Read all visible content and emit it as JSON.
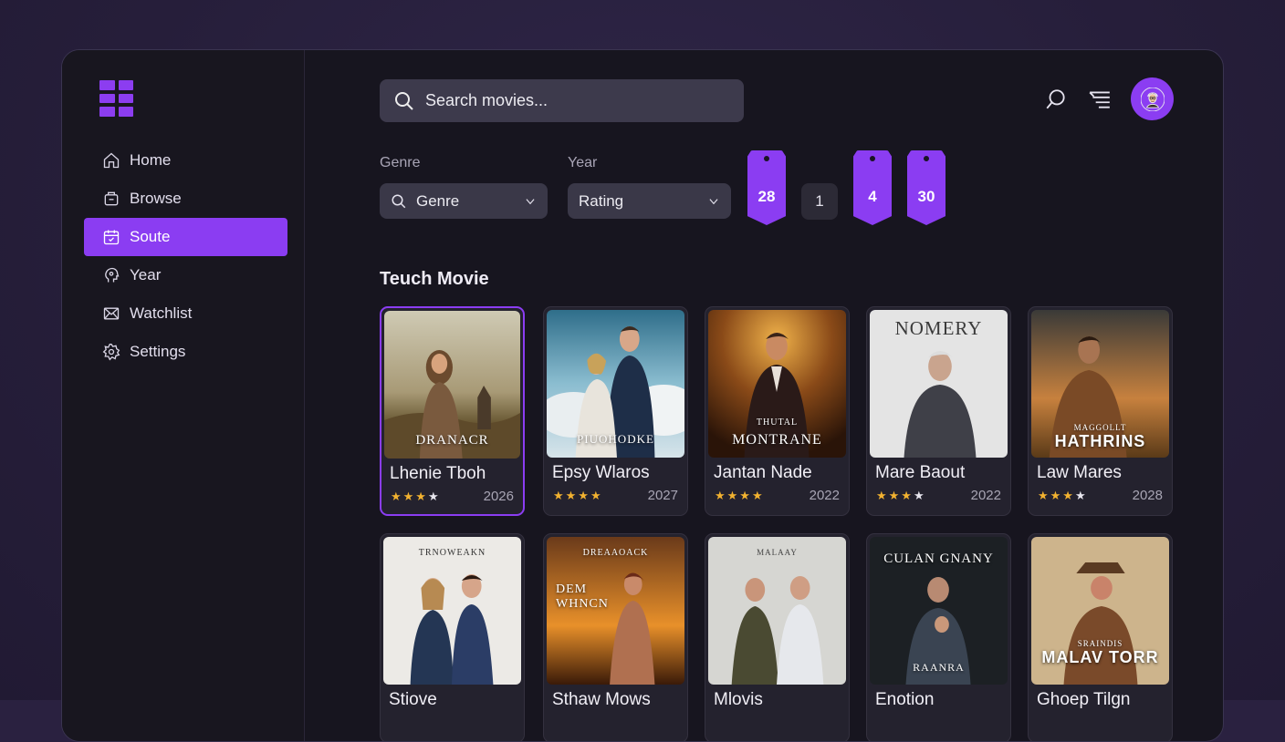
{
  "sidebar": {
    "items": [
      {
        "label": "Home",
        "icon": "home-icon",
        "active": false
      },
      {
        "label": "Browse",
        "icon": "browse-icon",
        "active": false
      },
      {
        "label": "Soute",
        "icon": "calendar-icon",
        "active": true
      },
      {
        "label": "Year",
        "icon": "head-icon",
        "active": false
      },
      {
        "label": "Watchlist",
        "icon": "envelope-icon",
        "active": false
      },
      {
        "label": "Settings",
        "icon": "gear-icon",
        "active": false
      }
    ]
  },
  "header": {
    "search_placeholder": "Search movies...",
    "icons": [
      "search-icon",
      "filter-menu-icon"
    ],
    "avatar": "user-avatar"
  },
  "filters": {
    "genre_label": "Genre",
    "genre_value": "Genre",
    "year_label": "Year",
    "year_value": "Rating",
    "tags": [
      "28",
      "1",
      "4",
      "30"
    ]
  },
  "section_title": "Teuch Movie",
  "movies": [
    {
      "title": "Lhenie Tboh",
      "poster_text": "DRANACR",
      "rating": 3.5,
      "year": "2026"
    },
    {
      "title": "Epsy Wlaros",
      "poster_text": "PIUOHODKE",
      "rating": 4,
      "year": "2027"
    },
    {
      "title": "Jantan Nade",
      "poster_text": "MONTRANE",
      "poster_subtext": "THUTAL",
      "rating": 3.5,
      "year": "2022"
    },
    {
      "title": "Mare Baout",
      "poster_text": "NOMERY",
      "rating": 3.5,
      "year": "2022"
    },
    {
      "title": "Law Mares",
      "poster_text": "HATHRINS",
      "poster_subtext": "MAGGOLLT",
      "rating": 3.5,
      "year": "2028"
    },
    {
      "title": "Stiove",
      "poster_text": "TRNOWEAKN",
      "rating": null,
      "year": ""
    },
    {
      "title": "Sthaw Mows",
      "poster_text": "DEM WHNCN",
      "poster_subtext": "DREAAOACK",
      "rating": null,
      "year": ""
    },
    {
      "title": "Mlovis",
      "poster_text": "MALAAY",
      "rating": null,
      "year": ""
    },
    {
      "title": "Enotion",
      "poster_text": "CULAN GNANY",
      "poster_subtext": "RAANRA",
      "rating": null,
      "year": ""
    },
    {
      "title": "Ghoep Tilgn",
      "poster_text": "MALAV TORR",
      "poster_subtext": "SRAINDIS",
      "rating": null,
      "year": ""
    }
  ],
  "colors": {
    "accent": "#8b3df2",
    "star": "#f2b230",
    "window_bg": "#17151f"
  }
}
